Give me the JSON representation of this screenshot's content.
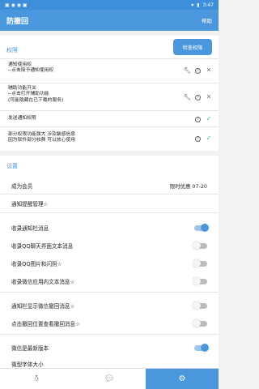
{
  "statusbar": {
    "time": "3:47",
    "battery": "▮",
    "wifi": "▾"
  },
  "appbar": {
    "title": "防撤回",
    "help": "帮助"
  },
  "permissions": {
    "section_title": "权限",
    "check_button": "检查权限",
    "rows": [
      {
        "text": [
          "通知使用权",
          "--点击授予通知使用权"
        ]
      },
      {
        "text": [
          "辅助功能开关",
          "--点击打开辅助功能",
          "(可能隐藏在已下载的服务)"
        ]
      },
      {
        "text": [
          "发送通知权限"
        ]
      },
      {
        "text": [
          "部分权限功能强大 涉及敏感信息",
          "因为软件部分收费 可以放心使用"
        ]
      }
    ]
  },
  "settings": {
    "section_title": "设置",
    "member_label": "成为会员",
    "member_value": "限时优惠 07-20",
    "notify_mgmt": "通知提醒管理☆",
    "toggles": [
      {
        "label": "收录通知栏消息",
        "on": true
      },
      {
        "label": "收录QQ聊天界面文本消息",
        "on": false
      },
      {
        "label": "收录QQ图片和闪照☆",
        "on": false
      },
      {
        "label": "收录微信应用内文本消息☆",
        "on": false
      },
      {
        "label": "通知栏显示微信撤回消息☆",
        "on": false
      },
      {
        "label": "点击撤回位置查看撤回消息☆",
        "on": false
      },
      {
        "label": "微信是最新版本",
        "on": true
      }
    ],
    "last_label": "微型字体大小"
  },
  "nav": {
    "active_index": 2
  }
}
